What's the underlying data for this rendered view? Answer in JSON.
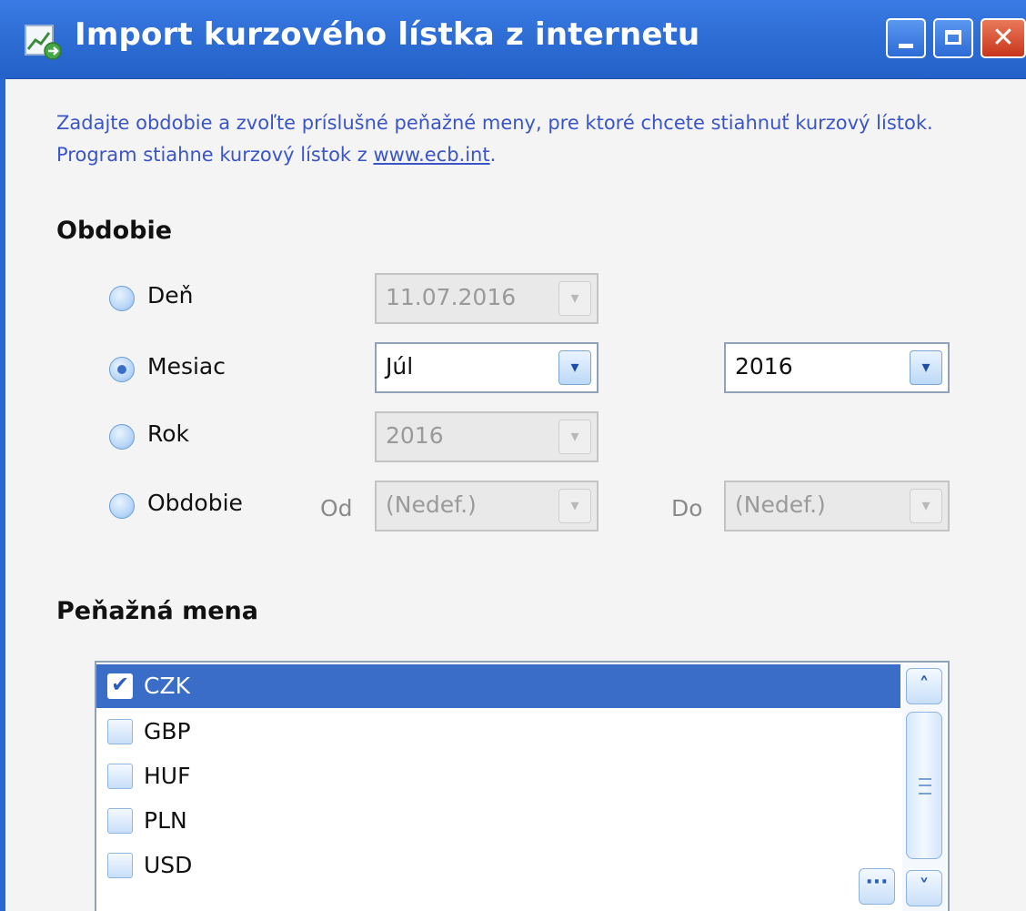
{
  "window": {
    "title": "Import kurzového lístka z internetu",
    "controls": {
      "minimize_icon": "minimize-icon",
      "maximize_icon": "maximize-icon",
      "close_label": "✕"
    }
  },
  "description": {
    "text": "Zadajte obdobie a zvoľte príslušné peňažné meny, pre ktoré chcete stiahnuť kurzový lístok. Program stiahne kurzový lístok z ",
    "link": "www.ecb.int",
    "trailing": "."
  },
  "period": {
    "heading": "Obdobie",
    "options": [
      {
        "label": "Deň",
        "selected": false
      },
      {
        "label": "Mesiac",
        "selected": true
      },
      {
        "label": "Rok",
        "selected": false
      },
      {
        "label": "Obdobie",
        "selected": false
      }
    ],
    "den_value": "11.07.2016",
    "month_value": "Júl",
    "month_year_value": "2016",
    "year_value": "2016",
    "from_label": "Od",
    "from_value": "(Nedef.)",
    "to_label": "Do",
    "to_value": "(Nedef.)"
  },
  "currency": {
    "heading": "Peňažná mena",
    "items": [
      {
        "label": "CZK",
        "checked": true,
        "selected": true
      },
      {
        "label": "GBP",
        "checked": false,
        "selected": false
      },
      {
        "label": "HUF",
        "checked": false,
        "selected": false
      },
      {
        "label": "PLN",
        "checked": false,
        "selected": false
      },
      {
        "label": "USD",
        "checked": false,
        "selected": false
      }
    ],
    "more_button_label": "···"
  },
  "colors": {
    "titlebar": "#2f6fd6",
    "description_text": "#3a55c8",
    "selection": "#3a6dc8"
  }
}
